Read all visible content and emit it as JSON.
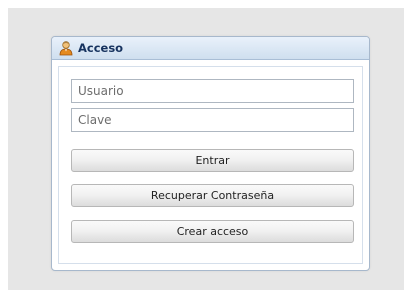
{
  "panel": {
    "title": "Acceso",
    "icon": "user-icon"
  },
  "form": {
    "username_placeholder": "Usuario",
    "username_value": "",
    "password_placeholder": "Clave",
    "password_value": ""
  },
  "buttons": {
    "login_label": "Entrar",
    "recover_label": "Recuperar Contraseña",
    "create_label": "Crear acceso"
  }
}
